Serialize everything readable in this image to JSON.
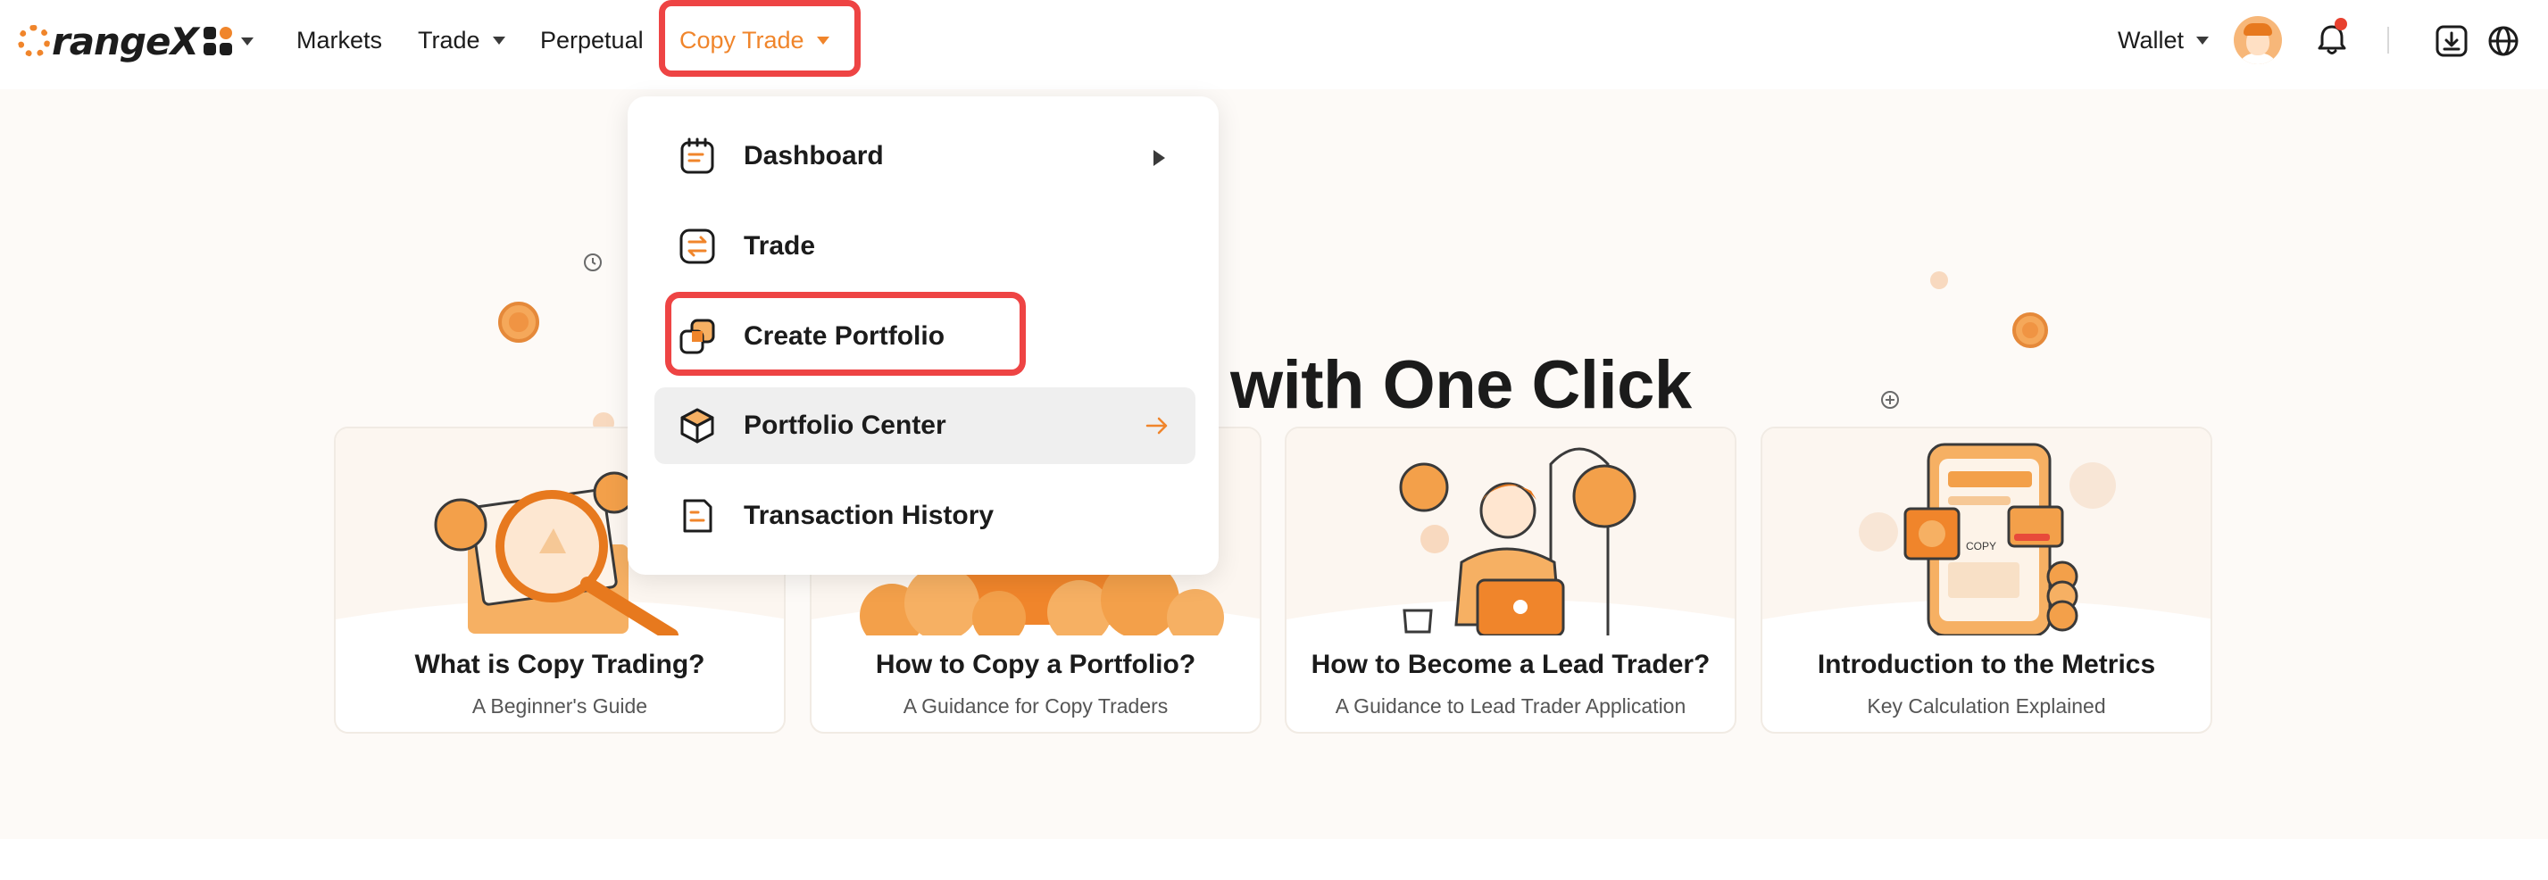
{
  "brand": {
    "logo_text": "rangeX",
    "accent_color": "#f0852b",
    "highlight_color": "#ee4444"
  },
  "nav": {
    "items": [
      {
        "label": "Markets"
      },
      {
        "label": "Trade"
      },
      {
        "label": "Perpetual"
      },
      {
        "label": "Copy Trade"
      }
    ],
    "wallet_label": "Wallet"
  },
  "icons": [
    "apps-grid-icon",
    "chevron-down-icon",
    "avatar",
    "bell-icon",
    "download-icon",
    "globe-icon",
    "triangle-right-icon",
    "arrow-right-icon"
  ],
  "dropdown": {
    "items": [
      {
        "label": "Dashboard",
        "icon": "notepad-icon"
      },
      {
        "label": "Trade",
        "icon": "swap-icon"
      },
      {
        "label": "Create Portfolio",
        "icon": "copy-squares-icon"
      },
      {
        "label": "Portfolio Center",
        "icon": "cube-icon"
      },
      {
        "label": "Transaction History",
        "icon": "document-icon"
      }
    ]
  },
  "hero": {
    "title_visible": "with One Click"
  },
  "cards": [
    {
      "title": "What is Copy Trading?",
      "subtitle": "A Beginner's Guide"
    },
    {
      "title": "How to Copy a Portfolio?",
      "subtitle": "A Guidance for Copy Traders"
    },
    {
      "title": "How to Become a Lead Trader?",
      "subtitle": "A Guidance to Lead Trader Application"
    },
    {
      "title": "Introduction to the Metrics",
      "subtitle": "Key Calculation Explained"
    }
  ],
  "card_art_text": {
    "copy_label": "COPY"
  }
}
